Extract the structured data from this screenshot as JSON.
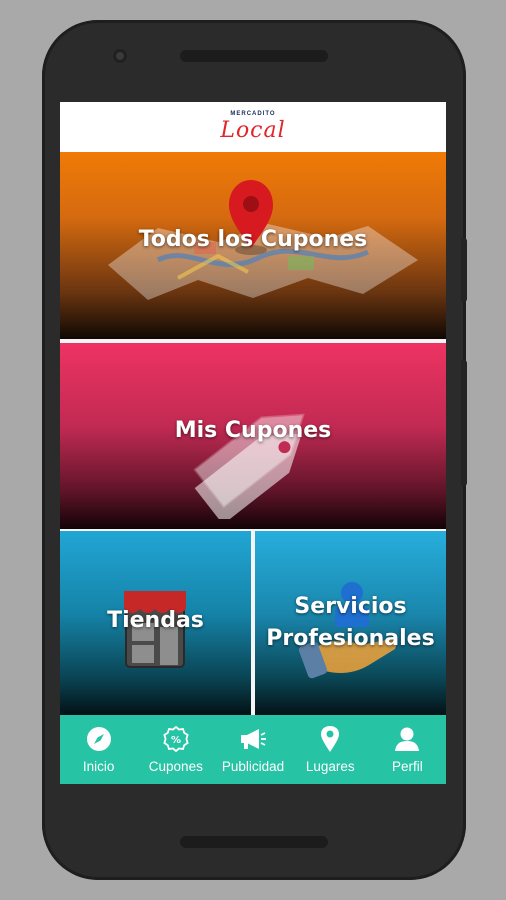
{
  "header": {
    "brand_top": "MERCADITO",
    "brand_script": "Local"
  },
  "tiles": {
    "todos": {
      "title": "Todos los Cupones",
      "icon": "map-pin-icon"
    },
    "mis": {
      "title": "Mis Cupones",
      "icon": "tag-icon"
    },
    "tiendas": {
      "title": "Tiendas",
      "icon": "store-icon"
    },
    "servicios": {
      "title_line1": "Servicios",
      "title_line2": "Profesionales",
      "icon": "professional-hand-icon"
    }
  },
  "bottom_nav": {
    "items": [
      {
        "label": "Inicio",
        "icon": "compass-icon"
      },
      {
        "label": "Cupones",
        "icon": "percent-badge-icon"
      },
      {
        "label": "Publicidad",
        "icon": "megaphone-icon"
      },
      {
        "label": "Lugares",
        "icon": "location-pin-icon"
      },
      {
        "label": "Perfil",
        "icon": "user-icon"
      }
    ]
  },
  "colors": {
    "background": "#a9a9a9",
    "phone_body": "#2b2b2b",
    "brand_red": "#e0262d",
    "brand_navy": "#1b2b5a",
    "tile_orange": "#f07a06",
    "tile_pink": "#ee3362",
    "tile_blue": "#21a6d4",
    "nav_teal": "#26c3a5"
  }
}
